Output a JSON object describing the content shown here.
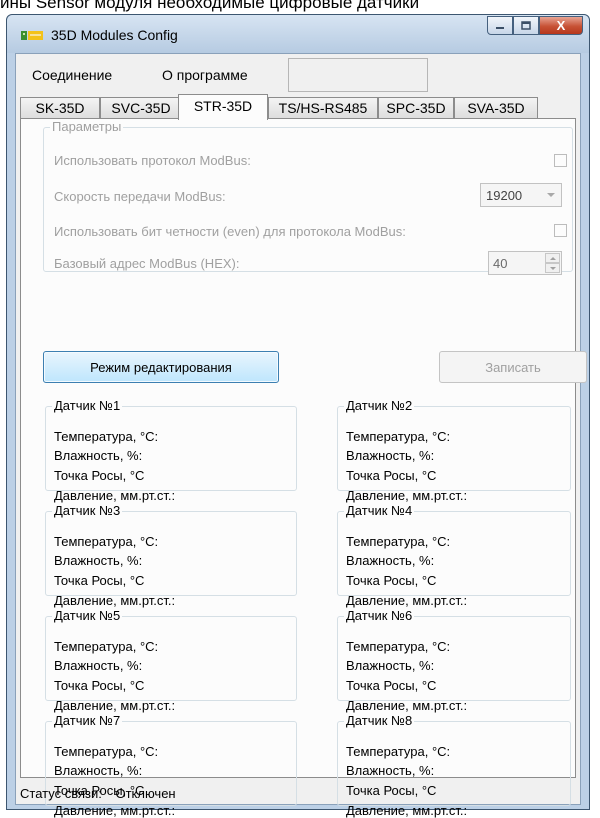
{
  "top_caption": "ины Sensor модуля необходимые цифровые датчики",
  "window": {
    "title": "35D Modules Config",
    "controls": {
      "minimize_icon": "minimize-icon",
      "maximize_icon": "maximize-icon",
      "close_icon": "close-icon",
      "close_label": "X"
    }
  },
  "menu": {
    "items": [
      "Соединение",
      "О программе"
    ]
  },
  "tabs": [
    {
      "label": "SK-35D"
    },
    {
      "label": "SVC-35D"
    },
    {
      "label": "STR-35D",
      "active": true
    },
    {
      "label": "TS/HS-RS485"
    },
    {
      "label": "SPC-35D"
    },
    {
      "label": "SVA-35D"
    }
  ],
  "params": {
    "legend": "Параметры",
    "use_modbus_label": "Использовать  протокол ModBus:",
    "use_modbus_checked": false,
    "speed_label": "Скорость передачи ModBus:",
    "speed_value": "19200",
    "parity_label": "Использовать бит четности (even) для протокола ModBus:",
    "parity_checked": false,
    "address_label": "Базовый адрес ModBus (HEX):",
    "address_value": "40"
  },
  "buttons": {
    "edit_mode": "Режим редактирования",
    "write": "Записать"
  },
  "sensors": [
    {
      "title": "Датчик №1",
      "temp": "Температура, °C:",
      "humidity": "Влажность, %:",
      "dew": "Точка Росы, °C",
      "pressure": "Давление, мм.рт.ст.:"
    },
    {
      "title": "Датчик №2",
      "temp": "Температура, °C:",
      "humidity": "Влажность, %:",
      "dew": "Точка Росы, °C",
      "pressure": "Давление, мм.рт.ст.:"
    },
    {
      "title": "Датчик №3",
      "temp": "Температура, °C:",
      "humidity": "Влажность, %:",
      "dew": "Точка Росы, °C",
      "pressure": "Давление, мм.рт.ст.:"
    },
    {
      "title": "Датчик №4",
      "temp": "Температура, °C:",
      "humidity": "Влажность, %:",
      "dew": "Точка Росы, °C",
      "pressure": "Давление, мм.рт.ст.:"
    },
    {
      "title": "Датчик №5",
      "temp": "Температура, °C:",
      "humidity": "Влажность, %:",
      "dew": "Точка Росы, °C",
      "pressure": "Давление, мм.рт.ст.:"
    },
    {
      "title": "Датчик №6",
      "temp": "Температура, °C:",
      "humidity": "Влажность, %:",
      "dew": "Точка Росы, °C",
      "pressure": "Давление, мм.рт.ст.:"
    },
    {
      "title": "Датчик №7",
      "temp": "Температура, °C:",
      "humidity": "Влажность, %:",
      "dew": "Точка Росы, °C",
      "pressure": "Давление, мм.рт.ст.:"
    },
    {
      "title": "Датчик №8",
      "temp": "Температура, °C:",
      "humidity": "Влажность, %:",
      "dew": "Точка Росы, °C",
      "pressure": "Давление, мм.рт.ст.:"
    }
  ],
  "status": {
    "label": "Статус связи:",
    "value": "Отключен"
  }
}
